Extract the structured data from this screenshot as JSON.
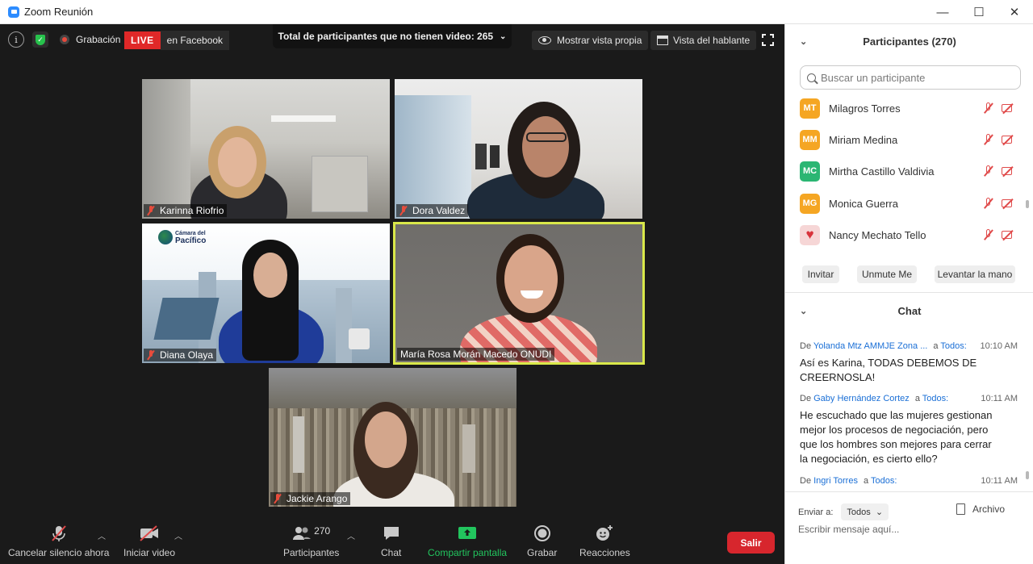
{
  "window": {
    "title": "Zoom Reunión",
    "controls": [
      "—",
      "☐",
      "✕"
    ]
  },
  "topbar": {
    "info_icon": "info-icon",
    "security_icon": "shield-icon",
    "recording_label": "Grabación",
    "live_label": "LIVE",
    "live_destination": "en Facebook",
    "no_video_text": "Total de participantes que no tienen video: 265",
    "show_self_view": "Mostrar vista propia",
    "speaker_view": "Vista del hablante"
  },
  "tiles": [
    {
      "name": "Karinna Riofrio",
      "muted": true
    },
    {
      "name": "Dora Valdez",
      "muted": true
    },
    {
      "name": "Diana Olaya",
      "muted": true,
      "logo_text_1": "Cámara del",
      "logo_text_2": "Pacífico"
    },
    {
      "name": "María Rosa Morán Macedo ONUDI",
      "muted": false,
      "active_speaker": true
    },
    {
      "name": "Jackie Arango",
      "muted": true
    }
  ],
  "toolbar": {
    "mute_label": "Cancelar silencio ahora",
    "video_label": "Iniciar video",
    "participants_count": "270",
    "participants_label": "Participantes",
    "chat_label": "Chat",
    "share_label": "Compartir pantalla",
    "record_label": "Grabar",
    "reactions_label": "Reacciones",
    "leave_label": "Salir",
    "colors": {
      "share": "#22c55e",
      "leave": "#d7262d"
    }
  },
  "participants_panel": {
    "title": "Participantes (270)",
    "search_placeholder": "Buscar un participante",
    "list": [
      {
        "initials": "MT",
        "name": "Milagros Torres",
        "color": "#f5a623"
      },
      {
        "initials": "MM",
        "name": "Miriam Medina",
        "color": "#f5a623"
      },
      {
        "initials": "MC",
        "name": "Mirtha Castillo Valdivia",
        "color": "#2bb673"
      },
      {
        "initials": "MG",
        "name": "Monica Guerra",
        "color": "#f5a623"
      },
      {
        "initials": "",
        "name": "Nancy Mechato Tello",
        "color": "#f4c6c6",
        "icon": "heart-icon"
      }
    ],
    "invite_label": "Invitar",
    "unmute_me_label": "Unmute Me",
    "raise_hand_label": "Levantar la mano"
  },
  "chat_panel": {
    "title": "Chat",
    "messages": [
      {
        "from_prefix": "De",
        "from": "Yolanda Mtz AMMJE Zona ...",
        "to_prefix": "a",
        "to": "Todos:",
        "time": "10:10 AM",
        "text": "Así es Karina, TODAS DEBEMOS DE CREERNOSLA!"
      },
      {
        "from_prefix": "De",
        "from": "Gaby Hernández Cortez",
        "to_prefix": "a",
        "to": "Todos:",
        "time": "10:11 AM",
        "text": "He escuchado que las mujeres gestionan mejor los procesos de negociación, pero que los hombres son mejores para cerrar la negociación, es cierto ello?"
      },
      {
        "from_prefix": "De",
        "from": "Ingri Torres",
        "to_prefix": "a",
        "to": "Todos:",
        "time": "10:11 AM",
        "text": ""
      }
    ],
    "send_to_label": "Enviar a:",
    "send_to_value": "Todos",
    "file_label": "Archivo",
    "compose_placeholder": "Escribir mensaje aquí..."
  }
}
